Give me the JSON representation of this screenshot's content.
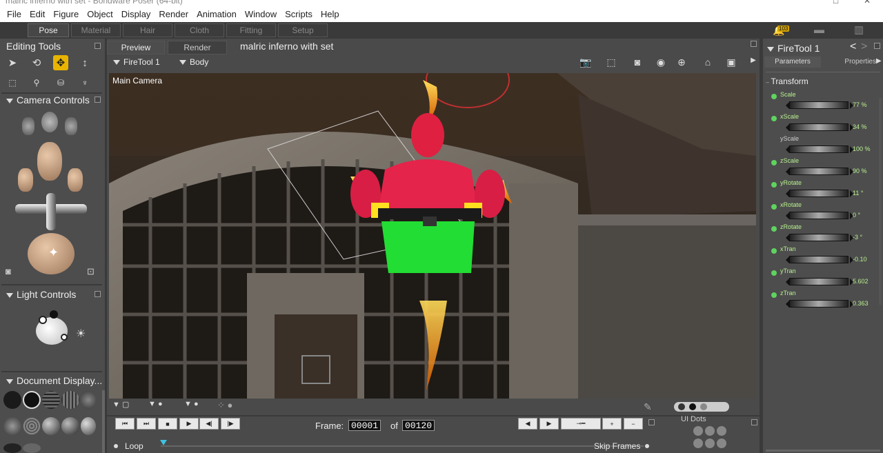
{
  "window": {
    "title": "malric inferno with set - Bondware Poser (64-bit)"
  },
  "menu": [
    "File",
    "Edit",
    "Figure",
    "Object",
    "Display",
    "Render",
    "Animation",
    "Window",
    "Scripts",
    "Help"
  ],
  "room_tabs": [
    "Pose",
    "Material",
    "Hair",
    "Cloth",
    "Fitting",
    "Setup"
  ],
  "active_room": "Pose",
  "notification_count": "103",
  "left": {
    "editing_tools": "Editing Tools",
    "camera_controls": "Camera Controls",
    "light_controls": "Light Controls",
    "document_display": "Document  Display..."
  },
  "viewport": {
    "tabs": [
      "Preview",
      "Render"
    ],
    "document_title": "malric inferno with set",
    "actor_select": "FireTool 1",
    "figure_select": "Body",
    "camera_label": "Main Camera"
  },
  "playback": {
    "frame_label": "Frame:",
    "current_frame": "00001",
    "of_label": "of",
    "total_frames": "00120",
    "loop_label": "Loop",
    "skip_frames_label": "Skip Frames",
    "ui_dots_label": "UI Dots"
  },
  "right": {
    "title": "FireTool 1",
    "tabs": [
      "Parameters",
      "Properties"
    ],
    "group": "Transform",
    "params": [
      {
        "name": "Scale",
        "value": "77 %",
        "active": true
      },
      {
        "name": "xScale",
        "value": "34 %",
        "active": true
      },
      {
        "name": "yScale",
        "value": "100 %",
        "active": false
      },
      {
        "name": "zScale",
        "value": "90 %",
        "active": true
      },
      {
        "name": "yRotate",
        "value": "11 °",
        "active": true
      },
      {
        "name": "xRotate",
        "value": "0 °",
        "active": true
      },
      {
        "name": "zRotate",
        "value": "-3 °",
        "active": true
      },
      {
        "name": "xTran",
        "value": "-0.10",
        "active": true
      },
      {
        "name": "yTran",
        "value": "5.602",
        "active": true
      },
      {
        "name": "zTran",
        "value": "0.363",
        "active": true
      }
    ]
  },
  "colors": {
    "accent": "#e8b400",
    "param_active": "#b8f08f",
    "dot": "#5fd35f"
  }
}
